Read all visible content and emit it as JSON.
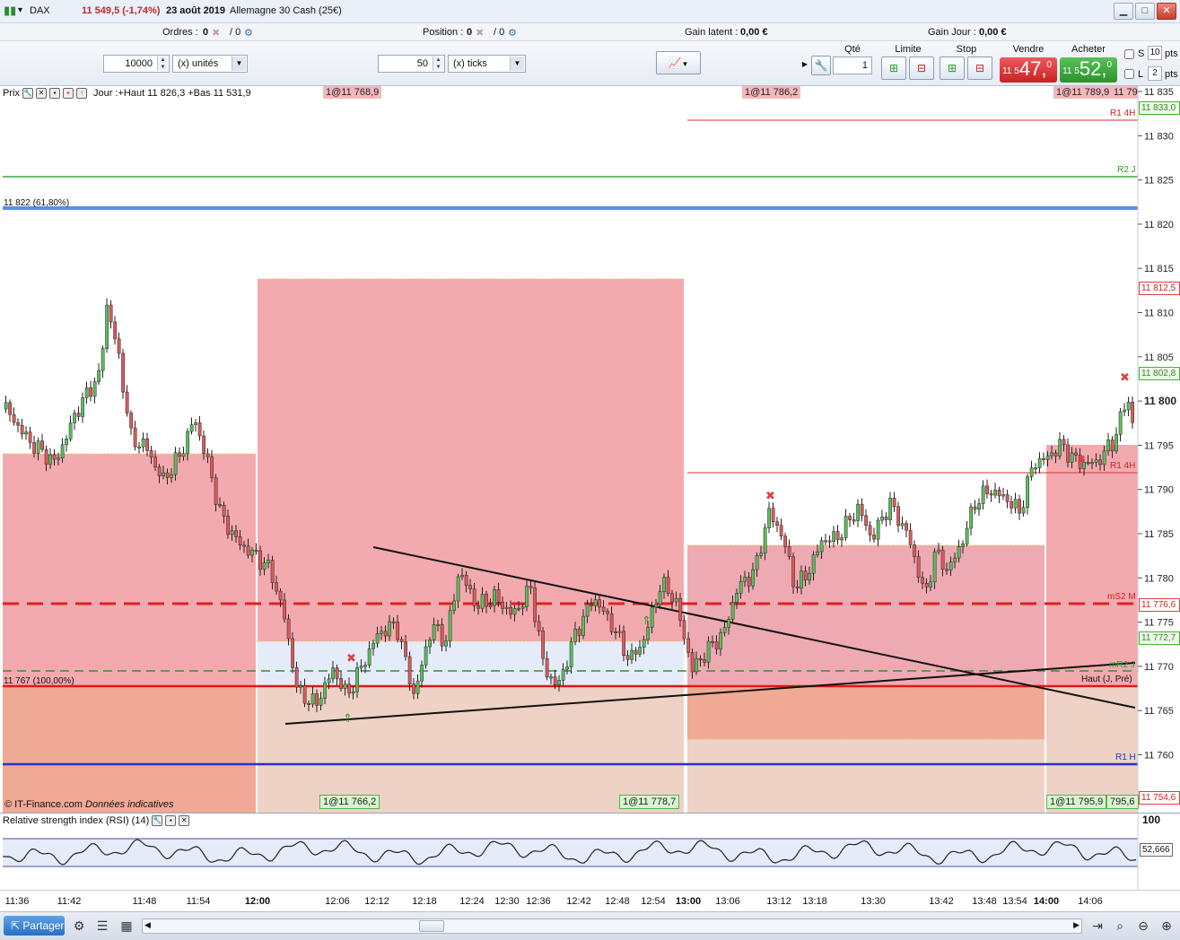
{
  "titlebar": {
    "instrument": "DAX",
    "last_price": "11 549,5 (-1,74%)",
    "date": "23 août 2019",
    "market": "Allemagne 30 Cash (25€)"
  },
  "infobar": {
    "orders_label": "Ordres :",
    "orders_value": "0",
    "orders_total": "/ 0",
    "position_label": "Position :",
    "position_value": "0",
    "position_total": "/ 0",
    "latent_label": "Gain latent :",
    "latent_value": "0,00 €",
    "day_label": "Gain Jour :",
    "day_value": "0,00 €"
  },
  "orderbar": {
    "qty_amount": "10000",
    "qty_unit": "(x) unités",
    "ticks_amount": "50",
    "ticks_unit": "(x) ticks",
    "qte_label": "Qté",
    "qte_value": "1",
    "limite_label": "Limite",
    "stop_label": "Stop",
    "vendre_label": "Vendre",
    "acheter_label": "Acheter",
    "sell_prefix": "11 5",
    "sell_big": "47,",
    "sell_sup": "0",
    "buy_prefix": "11 5",
    "buy_big": "52,",
    "buy_sup": "0",
    "s_label": "S",
    "s_value": "10",
    "l_label": "L",
    "l_value": "2",
    "pts_label": "pts",
    "accent_sell": "#e0363a",
    "accent_buy": "#3aa83a"
  },
  "chart": {
    "header_label": "Prix",
    "day_info": "Jour :+Haut 11 826,3 +Bas 11 531,9",
    "copyright": "© IT-Finance.com",
    "disclaimer": "Données indicatives",
    "fib_618": "11 822 (61,80%)",
    "fib_100": "11 767 (100,00%)",
    "lbl_r1_4h": "R1 4H",
    "lbl_r2_j": "R2 J",
    "lbl_ms2_m": "mS2 M",
    "lbl_mr2_j": "mR2 J",
    "lbl_haut": "Haut (J, Pré)",
    "lbl_r1_h": "R1 H",
    "lbl_r1_4h_b": "R1 4H",
    "top_tags": [
      "1@11 768,9",
      "1@11 786,2",
      "1@11 789,9",
      "11 79"
    ],
    "bottom_tags": [
      "1@11 766,2",
      "1@11 778,7",
      "1@11 795,9",
      "795,6"
    ],
    "y_ticks": [
      "11 835",
      "11 830",
      "11 825",
      "11 820",
      "11 815",
      "11 810",
      "11 805",
      "11 800",
      "11 795",
      "11 790",
      "11 785",
      "11 780",
      "11 775",
      "11 770",
      "11 765",
      "11 760"
    ],
    "y_tags": {
      "t1": "11 833,0",
      "t2": "11 812,5",
      "t3": "11 802,8",
      "t4": "11 776,6",
      "t5": "11 772,7",
      "t6": "11 754,6"
    },
    "y_ticks_range": [
      11758,
      11836
    ],
    "colors": {
      "up": "#5cbf5c",
      "down": "#e05a5a",
      "zone_pink": "#f2a5ab",
      "zone_salmon": "#f0a994",
      "fib_blue": "#5b8fe6",
      "r2_green": "#3aa83a"
    }
  },
  "rsi": {
    "title": "Relative strength index (RSI) (14)",
    "top_value": "100",
    "current_value": "52,666"
  },
  "time_axis": [
    "11:36",
    "11:42",
    "11:48",
    "11:54",
    "12:00",
    "12:06",
    "12:12",
    "12:18",
    "12:24",
    "12:30",
    "12:36",
    "12:42",
    "12:48",
    "12:54",
    "13:00",
    "13:06",
    "13:12",
    "13:18",
    "13:30",
    "13:42",
    "13:48",
    "13:54",
    "14:00",
    "14:06"
  ],
  "bottombar": {
    "share_label": "Partager"
  }
}
